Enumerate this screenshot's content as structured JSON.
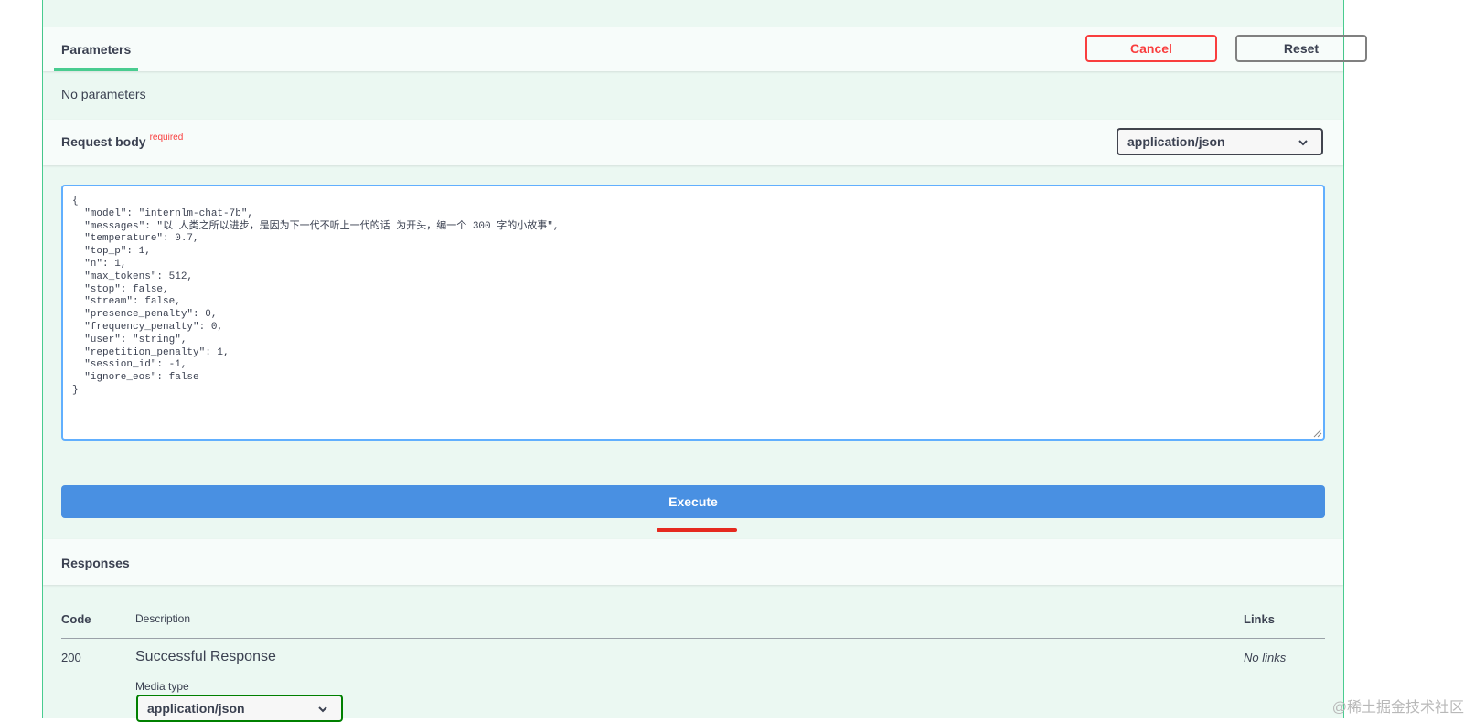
{
  "parameters": {
    "tab_label": "Parameters",
    "cancel_label": "Cancel",
    "reset_label": "Reset",
    "empty_text": "No parameters"
  },
  "request_body": {
    "title": "Request body",
    "required_label": "required",
    "content_type": "application/json",
    "body_text": "{\n  \"model\": \"internlm-chat-7b\",\n  \"messages\": \"以 人类之所以进步，是因为下一代不听上一代的话 为开头，编一个 300 字的小故事\",\n  \"temperature\": 0.7,\n  \"top_p\": 1,\n  \"n\": 1,\n  \"max_tokens\": 512,\n  \"stop\": false,\n  \"stream\": false,\n  \"presence_penalty\": 0,\n  \"frequency_penalty\": 0,\n  \"user\": \"string\",\n  \"repetition_penalty\": 1,\n  \"session_id\": -1,\n  \"ignore_eos\": false\n}"
  },
  "execute_label": "Execute",
  "responses": {
    "title": "Responses",
    "columns": {
      "code": "Code",
      "description": "Description",
      "links": "Links"
    },
    "rows": [
      {
        "code": "200",
        "description": "Successful Response",
        "links": "No links",
        "media_type_label": "Media type",
        "media_type": "application/json"
      }
    ]
  },
  "watermark": "@稀土掘金技术社区",
  "colors": {
    "accent": "#49cc90",
    "cancel": "#f93e3e",
    "execute": "#4990e2",
    "background": "#ebf8f2"
  }
}
